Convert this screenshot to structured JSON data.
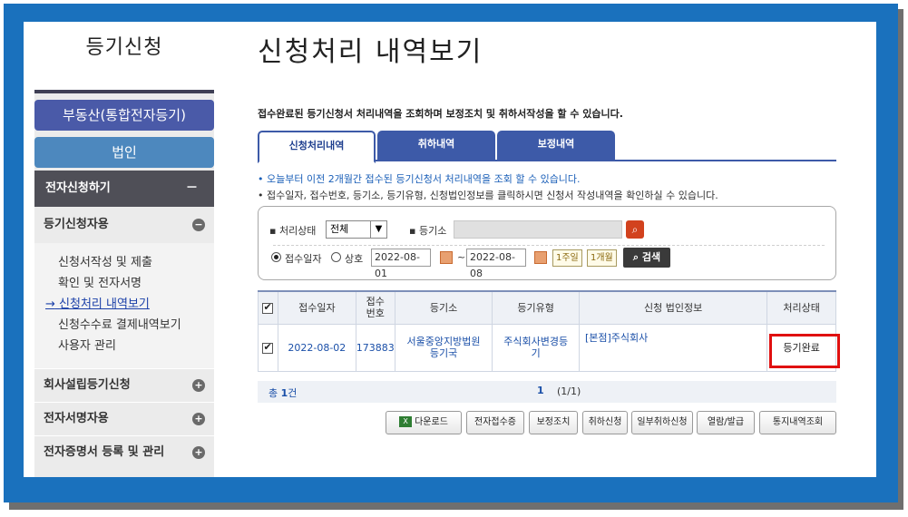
{
  "sidebar": {
    "title": "등기신청",
    "realestate_btn": "부동산(통합전자등기)",
    "corp_btn": "법인",
    "section_apply": "전자신청하기",
    "section_apply_toggle": "－",
    "section_user": "등기신청자용",
    "submenu": [
      "신청서작성 및 제출",
      "확인 및 전자서명",
      "신청처리 내역보기",
      "신청수수료 결제내역보기",
      "사용자 관리"
    ],
    "active_prefix": "→",
    "section_company": "회사설립등기신청",
    "section_esign": "전자서명자용",
    "section_cert": "전자증명서 등록 및 관리"
  },
  "main": {
    "page_title": "신청처리 내역보기",
    "intro": "접수완료된 등기신청서 처리내역을 조회하며 보정조치 및 취하서작성을 할 수 있습니다.",
    "tabs": [
      "신청처리내역",
      "취하내역",
      "보정내역"
    ],
    "note1": "• 오늘부터 이전 2개월간 접수된 등기신청서 처리내역을 조회 할 수 있습니다.",
    "note2": "• 접수일자, 접수번호, 등기소, 등기유형, 신청법인정보를 클릭하시면 신청서 작성내역을 확인하실 수 있습니다."
  },
  "search": {
    "status_label": "▪ 처리상태",
    "status_value": "전체",
    "registry_label": "▪ 등기소",
    "radio_date": "접수일자",
    "radio_name": "상호",
    "date_from": "2022-08-01",
    "tilde": "~",
    "date_to": "2022-08-08",
    "btn_week": "1주일",
    "btn_month": "1개월",
    "btn_search": "검색"
  },
  "table": {
    "headers": [
      "접수일자",
      "접수\n번호",
      "등기소",
      "등기유형",
      "신청 법인정보",
      "처리상태"
    ],
    "rows": [
      {
        "date": "2022-08-02",
        "number": "173883",
        "office": "서울중앙지방법원\n등기국",
        "type": "주식회사변경등\n기",
        "corp": "[본점]주식회사",
        "status": "등기완료"
      }
    ]
  },
  "footer": {
    "total_prefix": "총 ",
    "total_count": "1",
    "total_suffix": "건",
    "page_current": "1",
    "page_of": "(1/1)"
  },
  "actions": [
    "다운로드",
    "전자접수증",
    "보정조치",
    "취하신청",
    "일부취하신청",
    "열람/발급",
    "통지내역조회"
  ]
}
